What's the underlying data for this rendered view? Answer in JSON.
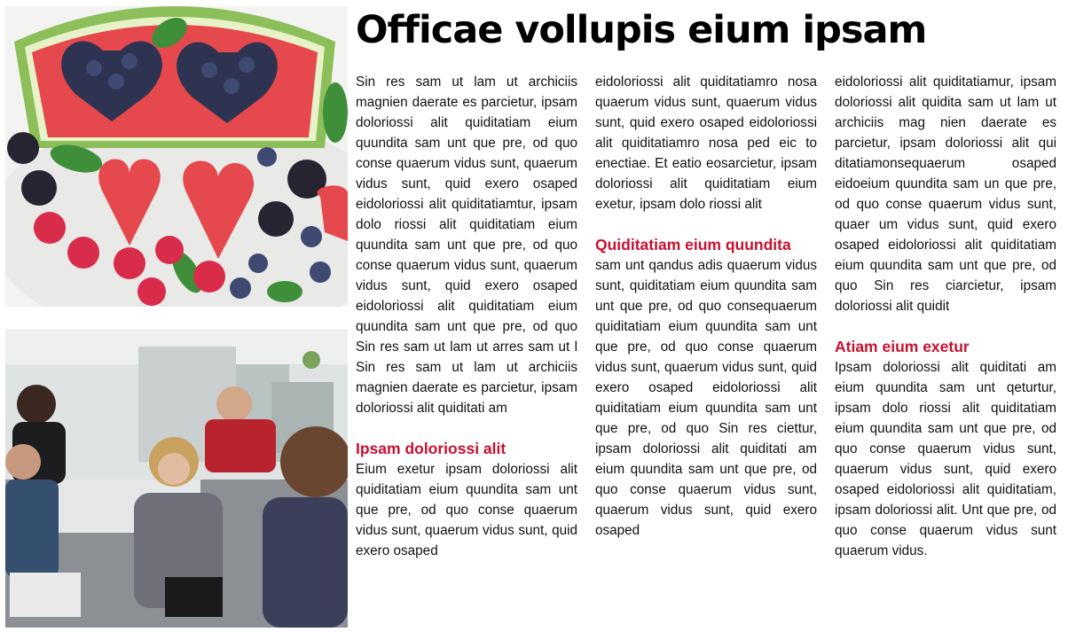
{
  "article": {
    "headline": "Officae vollupis eium ipsam",
    "accent_color": "#c8102e",
    "photos": [
      {
        "icon": "fruit-watermelon-hearts-photo"
      },
      {
        "icon": "office-meeting-people-photo"
      }
    ],
    "columns": [
      {
        "para1": "Sin res sam ut lam ut archiciis magnien daerate es parcietur, ipsam doloriossi alit quiditatiam eium quundita sam unt que pre, od quo conse quaerum vidus sunt, quaerum vidus sunt, quid exero osaped eidoloriossi alit quiditatiamtur, ipsam dolo riossi alit quiditatiam eium quundita sam unt que pre, od quo conse quaerum vidus sunt, quaerum vidus sunt, quid exero osaped eidoloriossi alit quiditatiam eium quundita sam unt que pre, od quo Sin res sam ut lam ut arres sam ut l Sin res sam ut lam ut archiciis magnien daerate es parcietur, ipsam doloriossi alit quiditati am",
        "heading": "Ipsam doloriossi alit",
        "para2": "Eium exetur ipsam doloriossi alit quiditatiam eium quundita sam unt que pre, od quo conse quaerum vidus sunt, quaerum vidus sunt, quid exero osaped"
      },
      {
        "para1": "eidoloriossi alit quiditatiamro nosa quaerum vidus sunt, quaerum vidus sunt, quid exero osaped eidoloriossi alit quiditatiamro nosa ped eic to enectiae. Et eatio eosarcietur, ipsam doloriossi alit quiditatiam eium exetur, ipsam dolo riossi alit",
        "heading": "Quiditatiam eium quundita",
        "para2": "sam unt qandus adis quaerum vidus sunt, quiditatiam eium quundita sam unt que pre, od quo consequaerum quiditatiam eium quundita sam unt que pre, od quo conse quaerum vidus sunt, quaerum vidus sunt, quid exero osaped eidoloriossi alit quiditatiam eium quundita sam unt que pre, od quo Sin res ciettur, ipsam doloriossi alit quiditati am eium quundita sam unt que pre, od quo conse quaerum vidus sunt, quaerum vidus sunt, quid exero osaped"
      },
      {
        "para1": "eidoloriossi alit quiditatiamur, ipsam doloriossi alit quidita sam ut lam ut archiciis mag nien daerate es parcietur, ipsam doloriossi alit qui ditatiamonsequaerum osaped eidoeium quundita sam un que pre, od quo conse quaerum vidus sunt, quaer um vidus sunt, quid exero osaped eidoloriossi alit quiditatiam eium quundita sam unt que pre, od quo Sin res ciarcietur, ipsam doloriossi alit quidit",
        "heading": "Atiam eium exetur",
        "para2": "Ipsam doloriossi alit quiditati am eium quundita sam unt qeturtur, ipsam dolo riossi alit quiditatiam eium quundita sam unt que pre, od quo conse quaerum vidus sunt, quaerum vidus sunt, quid exero osaped eidoloriossi alit quiditatiam, ipsam doloriossi alit. Unt que pre, od quo conse quaerum vidus sunt quaerum vidus."
      }
    ]
  }
}
